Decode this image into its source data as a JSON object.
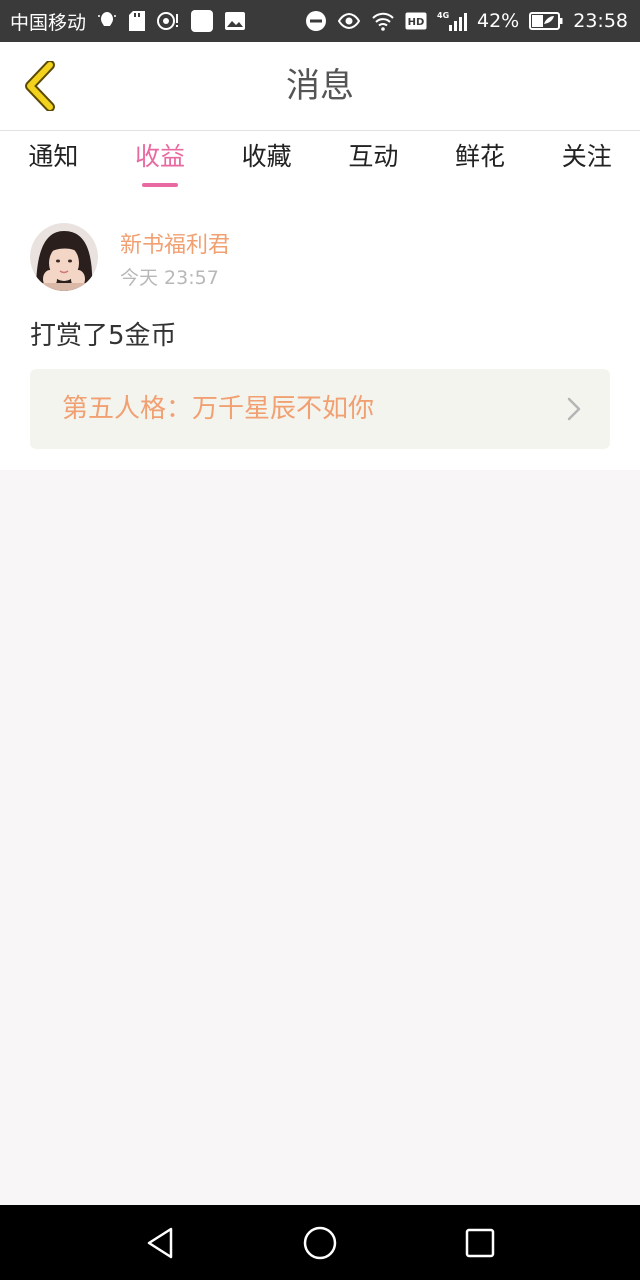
{
  "status_bar": {
    "carrier": "中国移动",
    "battery": "42%",
    "time": "23:58",
    "network_label": "4G",
    "hd_label": "HD"
  },
  "header": {
    "title": "消息"
  },
  "tabs": [
    {
      "label": "通知",
      "active": false
    },
    {
      "label": "收益",
      "active": true
    },
    {
      "label": "收藏",
      "active": false
    },
    {
      "label": "互动",
      "active": false
    },
    {
      "label": "鲜花",
      "active": false
    },
    {
      "label": "关注",
      "active": false
    }
  ],
  "message": {
    "sender": "新书福利君",
    "time": "今天 23:57",
    "text": "打赏了5金币",
    "book_title": "第五人格：万千星辰不如你"
  },
  "colors": {
    "accent_pink": "#e86aa0",
    "accent_orange": "#f1a072",
    "back_arrow": "#e2c400",
    "status_bar_bg": "#3a3a3a"
  }
}
